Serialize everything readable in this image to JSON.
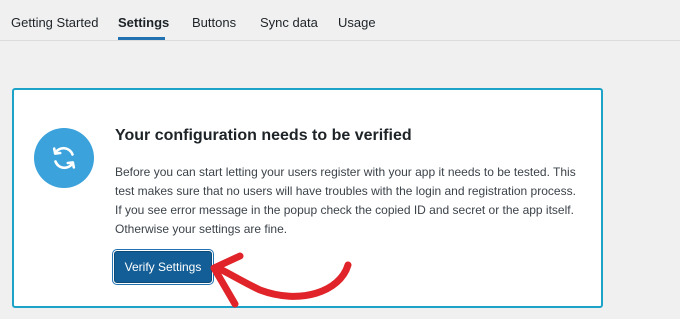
{
  "tabs": {
    "items": [
      {
        "label": "Getting Started"
      },
      {
        "label": "Settings"
      },
      {
        "label": "Buttons"
      },
      {
        "label": "Sync data"
      },
      {
        "label": "Usage"
      }
    ],
    "active": "Settings"
  },
  "notice": {
    "title": "Your configuration needs to be verified",
    "lines": [
      "Before you can start letting your users register with your app it needs to be tested. This",
      "test makes sure that no users will have troubles with the login and registration process.",
      "If you see error message in the popup check the copied ID and secret or the app itself.",
      "Otherwise your settings are fine."
    ],
    "icon": "sync-icon",
    "button_label": "Verify Settings"
  },
  "colors": {
    "accent": "#2271b1",
    "card_border": "#1ea3c8",
    "icon_circle": "#3ba2dc",
    "button": "#135e96",
    "annotation_arrow": "#e0242a"
  }
}
